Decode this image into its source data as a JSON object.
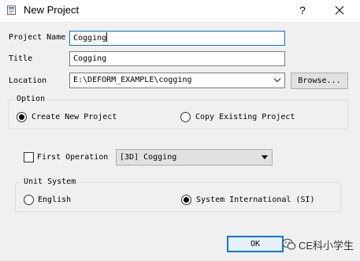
{
  "window": {
    "title": "New Project",
    "help_label": "?"
  },
  "form": {
    "project_name_label": "Project Name",
    "project_name_value": "Cogging",
    "title_label": "Title",
    "title_value": "Cogging",
    "location_label": "Location",
    "location_value": "E:\\DEFORM_EXAMPLE\\cogging",
    "browse_label": "Browse..."
  },
  "option_group": {
    "title": "Option",
    "create_new_label": "Create New Project",
    "copy_existing_label": "Copy Existing Project",
    "selected": "Create New Project"
  },
  "first_operation": {
    "label": "First Operation",
    "checked": false,
    "selected_value": "[3D] Cogging"
  },
  "unit_system": {
    "title": "Unit System",
    "english_label": "English",
    "si_label": "System International (SI)",
    "selected": "System International (SI)"
  },
  "buttons": {
    "ok_label": "OK"
  },
  "watermark": {
    "text": "CE科小学生"
  },
  "colors": {
    "accent": "#0078d7",
    "background": "#f0f0f0",
    "titlebar": "#ffffff"
  }
}
